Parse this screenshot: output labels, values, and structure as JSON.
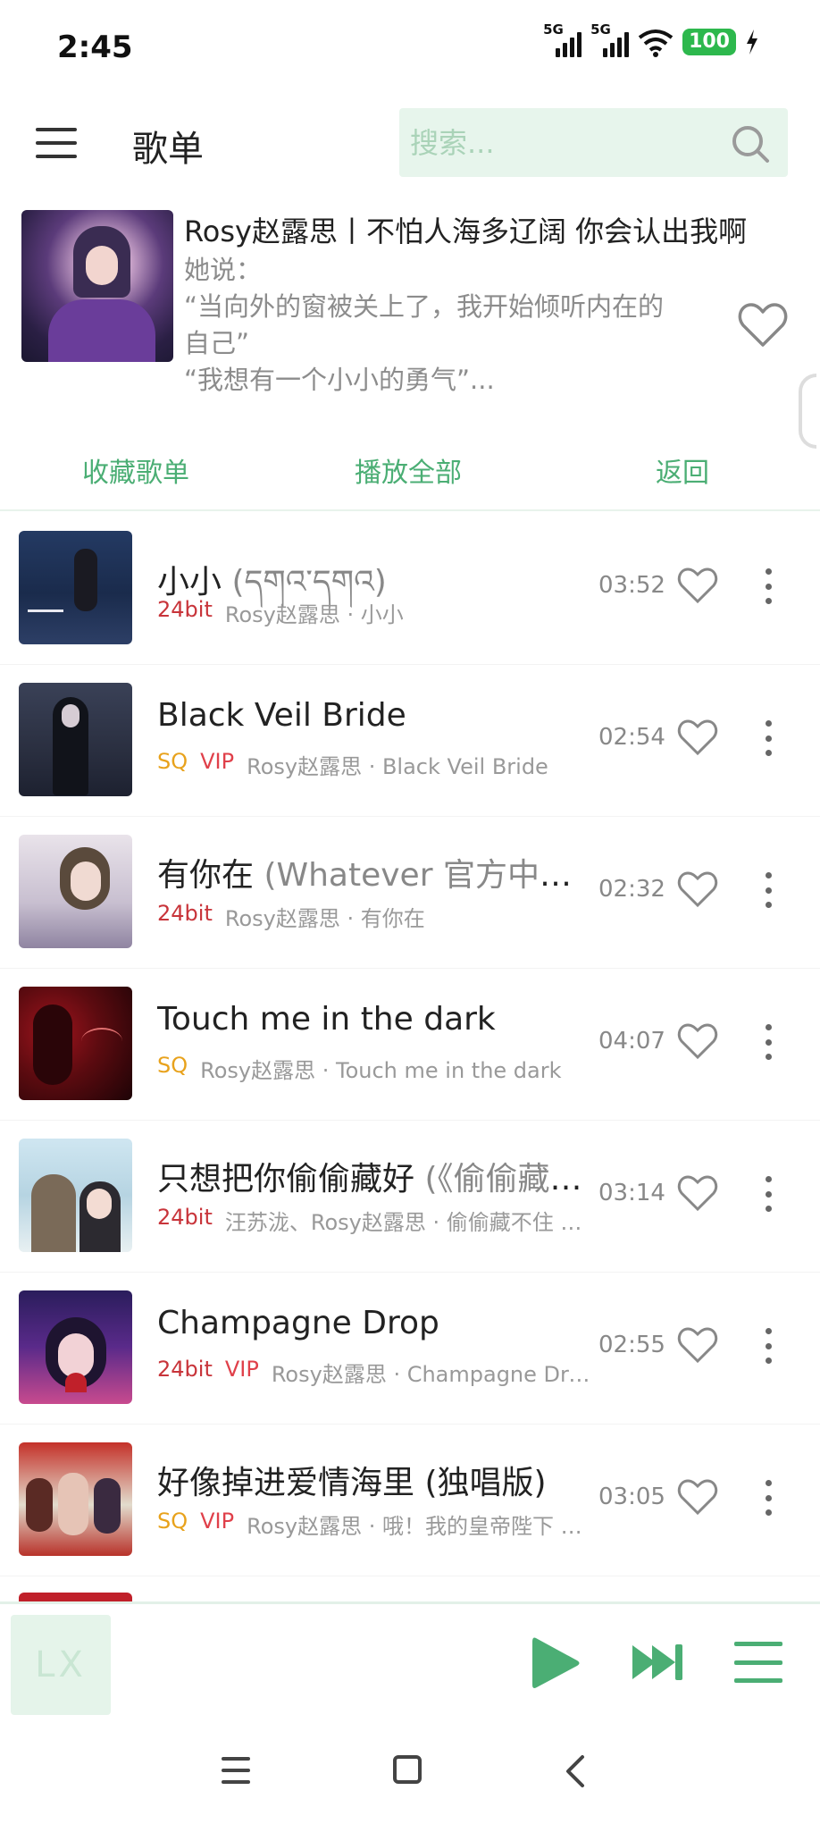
{
  "status": {
    "time": "2:45",
    "sim1": "5G",
    "sim2": "5G",
    "battery": "100"
  },
  "header": {
    "title": "歌单",
    "search_placeholder": "搜索..."
  },
  "playlist": {
    "title": "Rosy赵露思丨不怕人海多辽阔 你会认出我啊",
    "desc_lines": [
      "她说：",
      "“当向外的窗被关上了，我开始倾听内在的",
      "自己”",
      "“我想有一个小小的勇气”..."
    ]
  },
  "actions": {
    "collect": "收藏歌单",
    "play_all": "播放全部",
    "back": "返回"
  },
  "songs": [
    {
      "title": "小小",
      "subtitle": " (དགའ་དགའ)",
      "badges": [
        "24bit"
      ],
      "artist": "Rosy赵露思 · 小小",
      "duration": "03:52"
    },
    {
      "title": "Black Veil Bride",
      "subtitle": "",
      "badges": [
        "SQ",
        "VIP"
      ],
      "artist": "Rosy赵露思 · Black Veil Bride",
      "duration": "02:54"
    },
    {
      "title": "有你在",
      "subtitle": " (Whatever 官方中文版)",
      "badges": [
        "24bit"
      ],
      "artist": "Rosy赵露思 · 有你在",
      "duration": "02:32"
    },
    {
      "title": "Touch me in the dark",
      "subtitle": "",
      "badges": [
        "SQ"
      ],
      "artist": "Rosy赵露思 · Touch me in the dark",
      "duration": "04:07"
    },
    {
      "title": "只想把你偷偷藏好",
      "subtitle": " (《偷偷藏不住》影视剧插曲)",
      "badges": [
        "24bit"
      ],
      "artist": "汪苏泷、Rosy赵露思 · 偷偷藏不住 影视原声带",
      "duration": "03:14"
    },
    {
      "title": "Champagne Drop",
      "subtitle": "",
      "badges": [
        "24bit",
        "VIP"
      ],
      "artist": "Rosy赵露思 · Champagne Drop",
      "duration": "02:55"
    },
    {
      "title": "好像掉进爱情海里 (独唱版)",
      "subtitle": "",
      "badges": [
        "SQ",
        "VIP"
      ],
      "artist": "Rosy赵露思 · 哦！我的皇帝陛下 影视原声带",
      "duration": "03:05"
    }
  ],
  "player": {
    "logo": "LX"
  },
  "colors": {
    "accent": "#4bae74",
    "badge_24bit": "#c8343a",
    "badge_sq": "#e8a21c",
    "badge_vip": "#e0404a"
  }
}
